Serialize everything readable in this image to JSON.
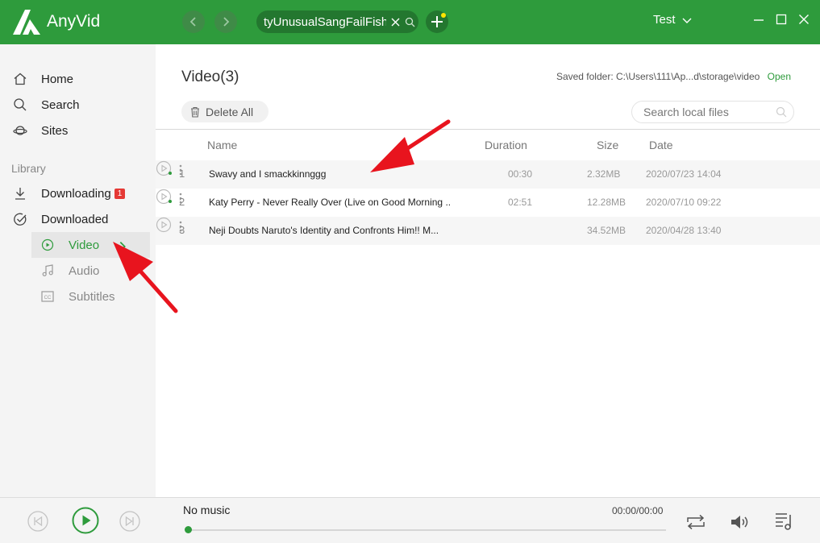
{
  "app": {
    "name": "AnyVid"
  },
  "header": {
    "back_icon": "chevron-left-icon",
    "forward_icon": "chevron-right-icon",
    "tab_label": "tyUnusualSangFailFish",
    "user": "Test",
    "accent": "#2e9b3c"
  },
  "sidebar": {
    "nav": [
      {
        "label": "Home",
        "icon": "home-icon"
      },
      {
        "label": "Search",
        "icon": "search-icon"
      },
      {
        "label": "Sites",
        "icon": "planet-icon"
      }
    ],
    "library_heading": "Library",
    "downloading": {
      "label": "Downloading",
      "badge": "1"
    },
    "downloaded": {
      "label": "Downloaded"
    },
    "sub": [
      {
        "label": "Video",
        "icon": "play-circle-icon",
        "active": true
      },
      {
        "label": "Audio",
        "icon": "music-note-icon"
      },
      {
        "label": "Subtitles",
        "icon": "cc-icon"
      }
    ]
  },
  "main": {
    "title": "Video(3)",
    "saved_folder_label": "Saved folder: C:\\Users\\111\\Ap...d\\storage\\video",
    "open_label": "Open",
    "delete_all": "Delete All",
    "search_placeholder": "Search local files",
    "columns": {
      "name": "Name",
      "duration": "Duration",
      "size": "Size",
      "date": "Date"
    },
    "rows": [
      {
        "num": "1",
        "name": "Swavy and I smackkinnggg",
        "duration": "00:30",
        "size": "2.32MB",
        "date": "2020/07/23 14:04",
        "new": true
      },
      {
        "num": "2",
        "name": "Katy Perry - Never Really Over (Live on Good Morning ..",
        "duration": "02:51",
        "size": "12.28MB",
        "date": "2020/07/10 09:22",
        "new": true
      },
      {
        "num": "3",
        "name": "Neji Doubts Naruto's Identity and Confronts Him!! M...",
        "duration": "",
        "size": "34.52MB",
        "date": "2020/04/28 13:40",
        "new": false
      }
    ]
  },
  "player": {
    "title": "No music",
    "time": "00:00/00:00",
    "progress": 0
  }
}
